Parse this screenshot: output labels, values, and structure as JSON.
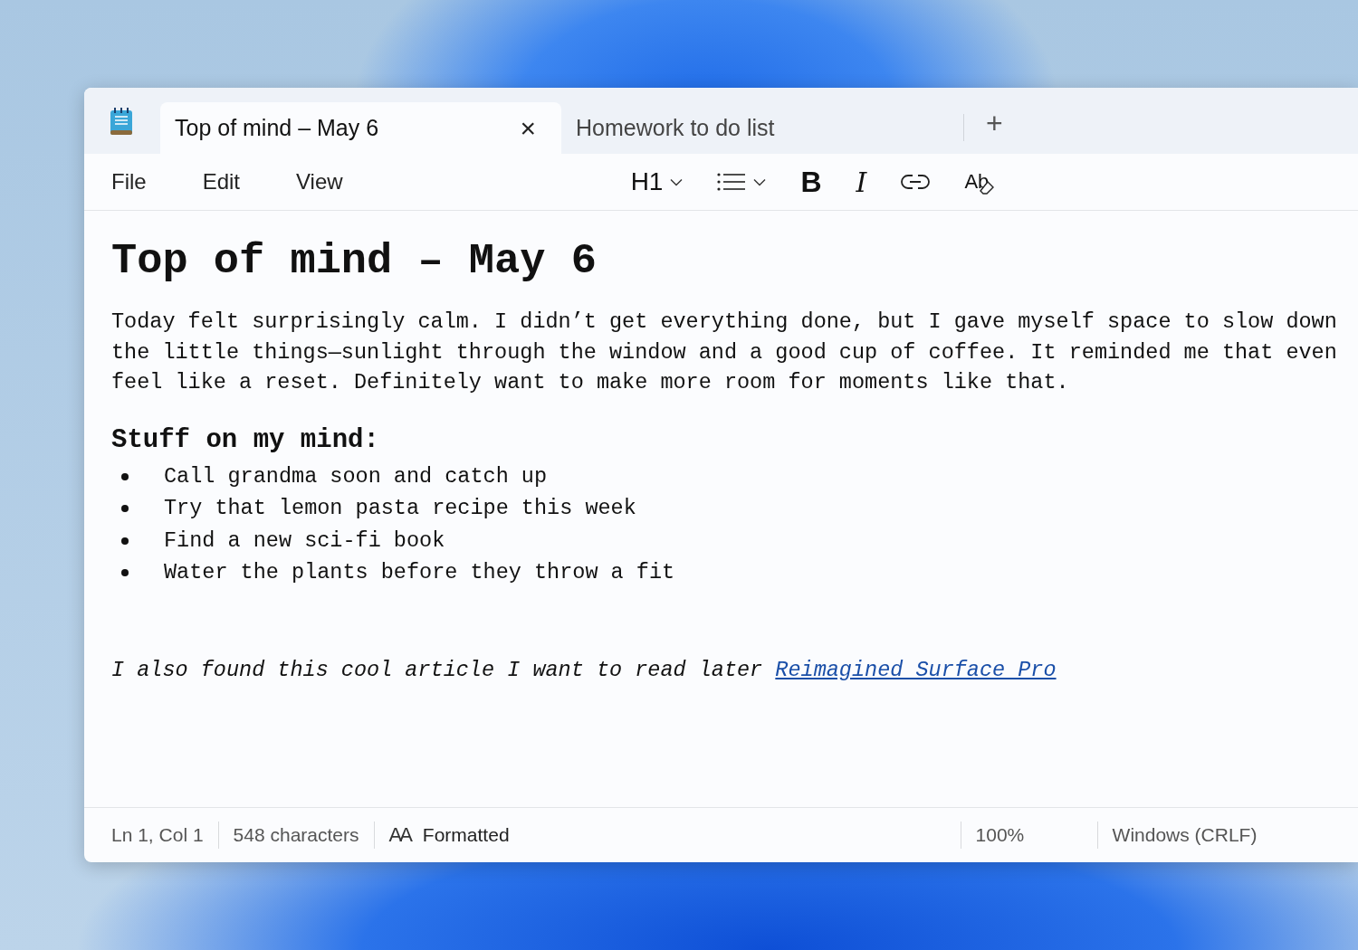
{
  "tabs": [
    {
      "title": "Top of mind – May 6",
      "selected": true,
      "close": "×"
    },
    {
      "title": "Homework to do list",
      "selected": false
    }
  ],
  "new_tab": "+",
  "menu": [
    "File",
    "Edit",
    "View"
  ],
  "toolbar": [
    {
      "kind": "heading",
      "label": "H1"
    },
    {
      "kind": "list"
    },
    {
      "kind": "bold",
      "label": "B"
    },
    {
      "kind": "italic",
      "label": "I"
    },
    {
      "kind": "link"
    },
    {
      "kind": "clear",
      "label": "Ab"
    }
  ],
  "document": {
    "title": "Top of mind – May 6",
    "paragraph_lines": [
      "Today felt surprisingly calm. I didn’t get everything done, but I gave myself space to slow down",
      "the little things—sunlight through the window and a good cup of coffee. It reminded me that even",
      "feel like a reset. Definitely want to make more room for moments like that."
    ],
    "subheading": "Stuff on my mind:",
    "bullets": [
      "Call grandma soon and catch up",
      "Try that lemon pasta recipe this week",
      "Find a new sci-fi book",
      "Water the plants before they throw a fit"
    ],
    "note": "I also found this cool article I want to read later",
    "link": "Reimagined Surface Pro"
  },
  "status_bar": {
    "position": "Ln 1, Col 1",
    "characters": "548 characters",
    "format_icon": "AA",
    "format": "Formatted",
    "zoom": "100%",
    "line_ending": "Windows (CRLF)"
  }
}
